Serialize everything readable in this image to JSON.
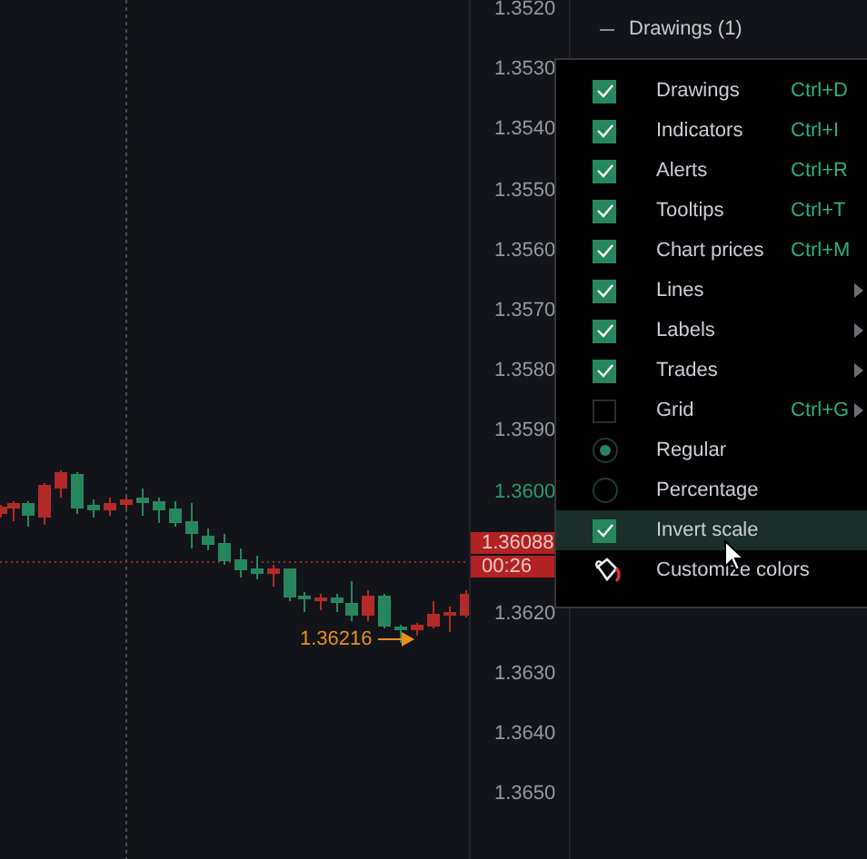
{
  "chart": {
    "last_low_label": "1.36216"
  },
  "price_axis": {
    "labels_above": [
      {
        "text": "1.3520",
        "highlighted": false
      },
      {
        "text": "1.3530",
        "highlighted": false
      },
      {
        "text": "1.3540",
        "highlighted": false
      },
      {
        "text": "1.3550",
        "highlighted": false
      },
      {
        "text": "1.3560",
        "highlighted": false
      },
      {
        "text": "1.3570",
        "highlighted": false
      },
      {
        "text": "1.3580",
        "highlighted": false
      },
      {
        "text": "1.3590",
        "highlighted": false
      },
      {
        "text": "1.3600",
        "highlighted": true
      }
    ],
    "price_badge": "1.36088",
    "timer_badge": "00:26",
    "labels_below": [
      {
        "text": "1.3620",
        "highlighted": false
      },
      {
        "text": "1.3630",
        "highlighted": false
      },
      {
        "text": "1.3640",
        "highlighted": false
      },
      {
        "text": "1.3650",
        "highlighted": false
      }
    ]
  },
  "panel": {
    "header": "Drawings (1)"
  },
  "menu": {
    "items": [
      {
        "kind": "checkbox",
        "label": "Drawings",
        "checked": true,
        "shortcut": "Ctrl+D",
        "submenu": false,
        "hovered": false
      },
      {
        "kind": "checkbox",
        "label": "Indicators",
        "checked": true,
        "shortcut": "Ctrl+I",
        "submenu": false,
        "hovered": false
      },
      {
        "kind": "checkbox",
        "label": "Alerts",
        "checked": true,
        "shortcut": "Ctrl+R",
        "submenu": false,
        "hovered": false
      },
      {
        "kind": "checkbox",
        "label": "Tooltips",
        "checked": true,
        "shortcut": "Ctrl+T",
        "submenu": false,
        "hovered": false
      },
      {
        "kind": "checkbox",
        "label": "Chart prices",
        "checked": true,
        "shortcut": "Ctrl+M",
        "submenu": false,
        "hovered": false
      },
      {
        "kind": "checkbox",
        "label": "Lines",
        "checked": true,
        "submenu": true,
        "hovered": false
      },
      {
        "kind": "checkbox",
        "label": "Labels",
        "checked": true,
        "submenu": true,
        "hovered": false
      },
      {
        "kind": "checkbox",
        "label": "Trades",
        "checked": true,
        "submenu": true,
        "hovered": false
      },
      {
        "kind": "checkbox",
        "label": "Grid",
        "checked": false,
        "shortcut": "Ctrl+G",
        "submenu": true,
        "hovered": false
      },
      {
        "kind": "radio",
        "label": "Regular",
        "selected": true,
        "submenu": false,
        "hovered": false
      },
      {
        "kind": "radio",
        "label": "Percentage",
        "selected": false,
        "submenu": false,
        "hovered": false
      },
      {
        "kind": "checkbox",
        "label": "Invert scale",
        "checked": true,
        "submenu": false,
        "hovered": true
      },
      {
        "kind": "action",
        "label": "Customize colors",
        "submenu": false,
        "hovered": false
      }
    ]
  }
}
